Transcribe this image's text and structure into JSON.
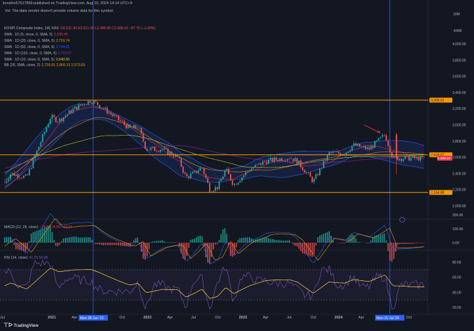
{
  "header": {
    "author": "kenshin57917859",
    "published": "published on TradingView.com, Aug 10, 2024 14:14 UTC+9"
  },
  "notice": "Vol: The data vendor doesn't provide volume data for this symbol.",
  "legend": {
    "symbol": "KOSPI Composite Index, 1W, KRX",
    "ohlc": "O2,611.30 H2,611.30 L2,386.96 C2,588.43 −87.76 (−3.28%)",
    "indicators": [
      {
        "label": "SMA · 1D (5, close, 0, SMA, 5)",
        "value": "2,535.45",
        "color": "#f23645"
      },
      {
        "label": "SMA · 1D (20, close, 0, SMA, 5)",
        "value": "2,716.74",
        "color": "#ff9800"
      },
      {
        "label": "SMA · 1D (60, close, 0, SMA, 5)",
        "value": "2,744.61",
        "color": "#2962ff"
      },
      {
        "label": "SMA · 1D (120, close, 0, SMA, 5)",
        "value": "2,715.67",
        "color": "#9c27b0"
      },
      {
        "label": "SMA · 1D (10, close, 0, SMA, 5)",
        "value": "2,640.55",
        "color": "#cddc39"
      },
      {
        "label": "BB (20, SMA, close, 2)",
        "value": "2,720.91  2,866.13  2,573.69",
        "color": "#ff9800"
      }
    ]
  },
  "macd_legend": {
    "label": "MACD (12, 26, close)",
    "values": "−18.51  24.59  −43.04"
  },
  "rsi_legend": {
    "label": "RSI (14, close)",
    "values": "41.29  56.99"
  },
  "price_axis": {
    "unit": "KRW",
    "top_label": "10M",
    "ticks": [
      "4,000.00",
      "3,800.00",
      "3,600.00",
      "3,400.00",
      "3,200.00",
      "3,000.00",
      "2,800.00",
      "2,600.00",
      "2,400.00",
      "2,200.00",
      "2,000.00"
    ]
  },
  "macd_axis": {
    "ticks": [
      "200.00",
      "100.00",
      "0.00"
    ]
  },
  "rsi_axis": {
    "ticks": [
      "80.00",
      "60.00",
      "40.00",
      "20.00"
    ]
  },
  "hlines": [
    {
      "value": "3,305.01",
      "color": "#ff9800"
    },
    {
      "value": "2,629.67",
      "color": "#ff9800"
    },
    {
      "value": "2,164.88",
      "color": "#ff9800"
    }
  ],
  "current_price": {
    "value": "2,588.43",
    "tag": "KOSPI",
    "color": "#f23645"
  },
  "vertical_labels": [
    {
      "text": "Mon 28 Jun '21",
      "color": "#2962ff"
    },
    {
      "text": "Mon 15 Jul '24",
      "color": "#2962ff"
    }
  ],
  "time_axis": [
    "Jul",
    "2021",
    "Apr",
    "Jul",
    "Oct",
    "2022",
    "Apr",
    "Jul",
    "Oct",
    "2023",
    "Apr",
    "Jul",
    "Oct",
    "2024",
    "Apr",
    "Oct"
  ],
  "footer": "TradingView",
  "colors": {
    "bg": "#131722",
    "candle_up": "#26a69a",
    "candle_down": "#ef5350",
    "hline": "#ff9800",
    "vline": "#2962ff",
    "bb": "#2962ff",
    "rsi": "#7e57c2",
    "rsi_ma": "#fdd835"
  },
  "chart_data": {
    "type": "candlestick",
    "interval": "1W",
    "symbol": "KOSPI",
    "ylim": [
      1950,
      4280
    ],
    "trend_points": [
      [
        "2020-06",
        2100
      ],
      [
        "2020-08",
        2400
      ],
      [
        "2020-10",
        2350
      ],
      [
        "2020-11",
        2600
      ],
      [
        "2020-12",
        2850
      ],
      [
        "2021-01",
        3100
      ],
      [
        "2021-02",
        3050
      ],
      [
        "2021-04",
        3200
      ],
      [
        "2021-06",
        3300
      ],
      [
        "2021-07",
        3250
      ],
      [
        "2021-09",
        3100
      ],
      [
        "2021-11",
        2950
      ],
      [
        "2021-12",
        2980
      ],
      [
        "2022-01",
        2700
      ],
      [
        "2022-03",
        2700
      ],
      [
        "2022-05",
        2600
      ],
      [
        "2022-06",
        2350
      ],
      [
        "2022-07",
        2400
      ],
      [
        "2022-08",
        2480
      ],
      [
        "2022-09",
        2200
      ],
      [
        "2022-10",
        2230
      ],
      [
        "2022-11",
        2450
      ],
      [
        "2022-12",
        2260
      ],
      [
        "2023-02",
        2450
      ],
      [
        "2023-04",
        2550
      ],
      [
        "2023-07",
        2600
      ],
      [
        "2023-08",
        2550
      ],
      [
        "2023-10",
        2300
      ],
      [
        "2023-12",
        2650
      ],
      [
        "2024-02",
        2650
      ],
      [
        "2024-03",
        2750
      ],
      [
        "2024-05",
        2700
      ],
      [
        "2024-07",
        2880
      ],
      [
        "2024-08",
        2588
      ]
    ]
  }
}
